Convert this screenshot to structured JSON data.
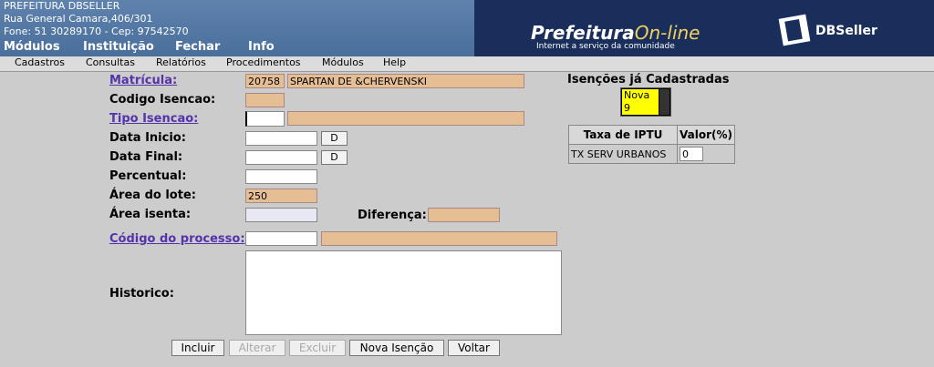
{
  "header": {
    "org_name": "PREFEITURA DBSELLER",
    "address": "Rua General Camara,406/301",
    "contact": "Fone: 51 30289170  -  Cep: 97542570",
    "top_menu": [
      "Módulos",
      "Instituição",
      "Fechar",
      "Info"
    ],
    "banner_title_main": "Prefeitura",
    "banner_title_accent": "On-line",
    "banner_subtitle": "Internet a serviço da comunidade",
    "brand": "DBSeller"
  },
  "menubar": [
    "Cadastros",
    "Consultas",
    "Relatórios",
    "Procedimentos",
    "Módulos",
    "Help"
  ],
  "form": {
    "matricula_label": "Matrícula:",
    "matricula_value": "20758",
    "matricula_name": "SPARTAN DE &CHERVENSKI",
    "codigo_label": "Codigo Isencao:",
    "codigo_value": "",
    "tipo_label": "Tipo Isencao:",
    "tipo_value": "",
    "tipo_desc": "",
    "data_inicio_label": "Data Inicio:",
    "data_inicio_value": "",
    "data_final_label": "Data Final:",
    "data_final_value": "",
    "date_button": "D",
    "percentual_label": "Percentual:",
    "percentual_value": "",
    "area_lote_label": "Área do lote:",
    "area_lote_value": "250",
    "area_isenta_label": "Área isenta:",
    "area_isenta_value": "",
    "diferenca_label": "Diferença:",
    "diferenca_value": "",
    "processo_label": "Código do processo:",
    "processo_value": "",
    "processo_desc": "",
    "historico_label": "Historico:",
    "historico_value": ""
  },
  "buttons": {
    "incluir": "Incluir",
    "alterar": "Alterar",
    "excluir": "Excluir",
    "nova_isencao": "Nova Isenção",
    "voltar": "Voltar"
  },
  "side": {
    "title": "Isenções já Cadastradas",
    "list_items": [
      "Nova",
      "9"
    ],
    "table_headers": [
      "Taxa de IPTU",
      "Valor(%)"
    ],
    "table_rows": [
      {
        "taxa": "TX SERV URBANOS",
        "valor": "0"
      }
    ]
  },
  "colors": {
    "header_bg": "#4a6f9c",
    "readonly_field": "#e6be94",
    "link": "#5533aa",
    "list_bg": "#ffff00"
  }
}
